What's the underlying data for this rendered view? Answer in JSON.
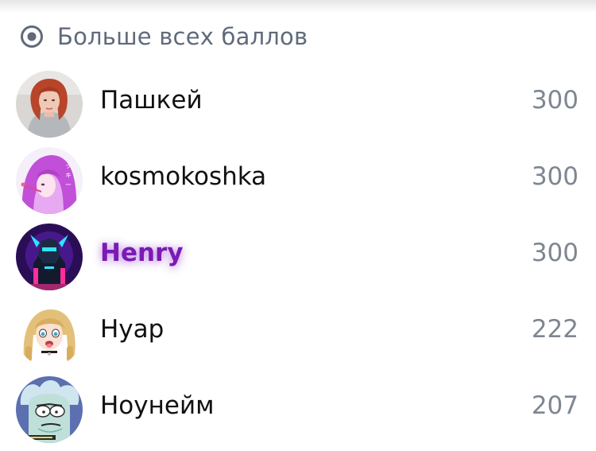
{
  "header": {
    "icon": "radio-target-icon",
    "title": "Больше всех баллов"
  },
  "leaderboard": [
    {
      "name": "Пашкей",
      "score": "300",
      "avatar": "avatar-red-haired-woman",
      "highlight": false
    },
    {
      "name": "kosmokoshka",
      "score": "300",
      "avatar": "avatar-anime-pink-hair",
      "highlight": false
    },
    {
      "name": "Henry",
      "score": "300",
      "avatar": "avatar-neon-robot",
      "highlight": true,
      "highlight_color": "#7a1bb3"
    },
    {
      "name": "Нуар",
      "score": "222",
      "avatar": "avatar-anime-blonde",
      "highlight": false
    },
    {
      "name": "Ноунейм",
      "score": "207",
      "avatar": "avatar-cartoon-old-man",
      "highlight": false
    }
  ],
  "colors": {
    "header_text": "#5f6b7b",
    "name_text": "#111111",
    "score_text": "#7d8691",
    "highlight": "#7a1bb3"
  }
}
